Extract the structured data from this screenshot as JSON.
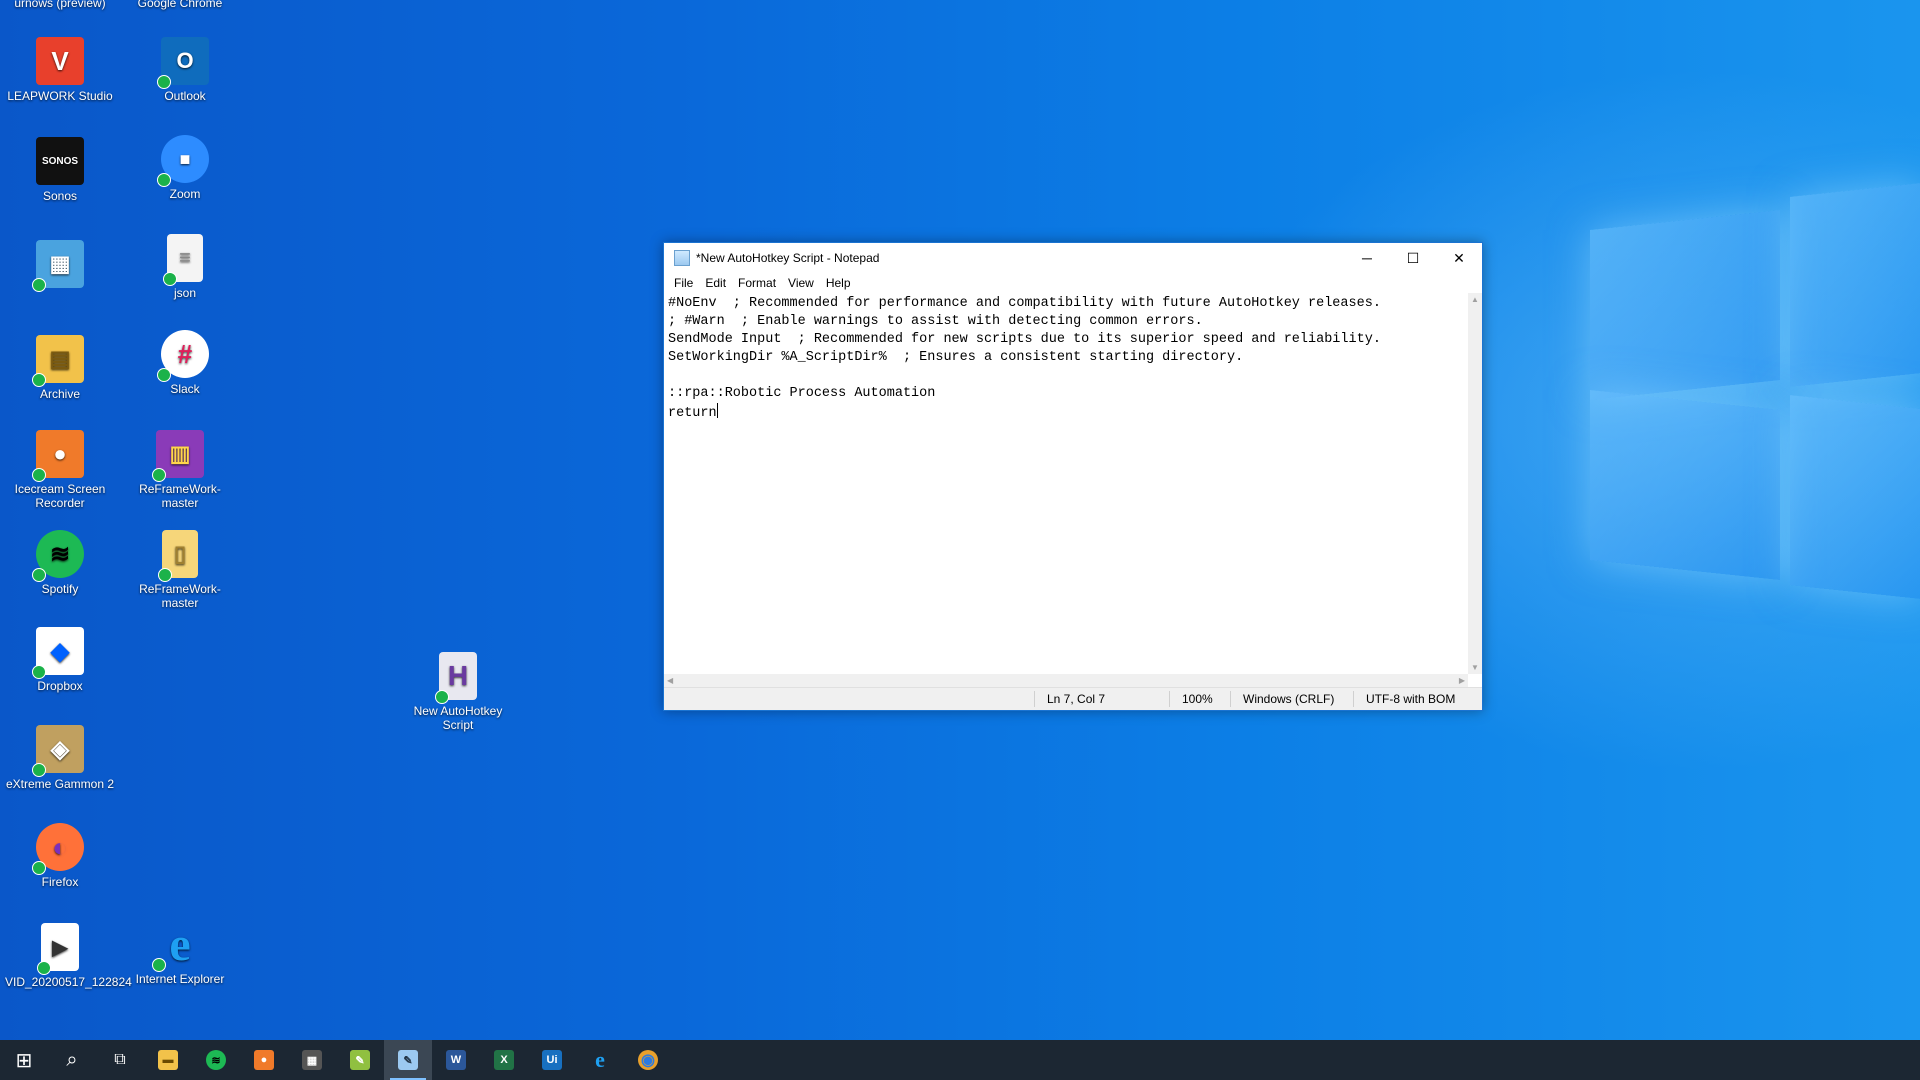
{
  "desktop": {
    "icons": [
      {
        "label": "LEAPWORK Studio",
        "color": "#e8402c",
        "glyph": "V"
      },
      {
        "label": "Outlook",
        "color": "#0f6cbd",
        "glyph": "O"
      },
      {
        "label": "Sonos",
        "color": "#111111",
        "glyph": "SONOS"
      },
      {
        "label": "Zoom",
        "color": "#2d8cff",
        "glyph": "■"
      },
      {
        "label": "",
        "color": "#4aa3df",
        "glyph": "▦"
      },
      {
        "label": "json",
        "color": "#f4f4f4",
        "glyph": "≡"
      },
      {
        "label": "Archive",
        "color": "#f2c24a",
        "glyph": "▤"
      },
      {
        "label": "Slack",
        "color": "#ffffff",
        "glyph": "#"
      },
      {
        "label": "Icecream Screen Recorder",
        "color": "#f07a2a",
        "glyph": "●"
      },
      {
        "label": "ReFrameWork-master",
        "color": "#8a3bb8",
        "glyph": "▥"
      },
      {
        "label": "Spotify",
        "color": "#1db954",
        "glyph": "≋"
      },
      {
        "label": "ReFrameWork-master",
        "color": "#f6d67a",
        "glyph": "▯"
      },
      {
        "label": "Dropbox",
        "color": "#ffffff",
        "glyph": "◆"
      },
      {
        "label": "New AutoHotkey Script",
        "color": "#e8e8f0",
        "glyph": "H"
      },
      {
        "label": "eXtreme Gammon 2",
        "color": "#c0a060",
        "glyph": "◈"
      },
      {
        "label": "Firefox",
        "color": "#ff7139",
        "glyph": "◐"
      },
      {
        "label": "VID_20200517_122824",
        "color": "#ffffff",
        "glyph": "▶"
      },
      {
        "label": "Internet Explorer",
        "color": "#1ea0f2",
        "glyph": "e"
      }
    ],
    "partial_top": [
      "urnows (preview)",
      "Google Chrome"
    ]
  },
  "notepad": {
    "title": "*New AutoHotkey Script - Notepad",
    "menu": [
      "File",
      "Edit",
      "Format",
      "View",
      "Help"
    ],
    "lines": [
      "#NoEnv  ; Recommended for performance and compatibility with future AutoHotkey releases.",
      "; #Warn  ; Enable warnings to assist with detecting common errors.",
      "SendMode Input  ; Recommended for new scripts due to its superior speed and reliability.",
      "SetWorkingDir %A_ScriptDir%  ; Ensures a consistent starting directory.",
      "",
      "::rpa::Robotic Process Automation",
      "return"
    ],
    "status": {
      "position": "Ln 7, Col 7",
      "zoom": "100%",
      "line_endings": "Windows (CRLF)",
      "encoding": "UTF-8 with BOM"
    },
    "controls": {
      "minimize": "─",
      "maximize": "☐",
      "close": "✕"
    }
  },
  "taskbar": {
    "start": "⊞",
    "search": "⌕",
    "taskview": "⧉",
    "apps": [
      {
        "name": "file-explorer",
        "glyph": "▬",
        "color": "#f2c24a"
      },
      {
        "name": "spotify",
        "glyph": "≋",
        "color": "#1db954"
      },
      {
        "name": "icecream",
        "glyph": "●",
        "color": "#f07a2a"
      },
      {
        "name": "calculator",
        "glyph": "▦",
        "color": "#ffffff"
      },
      {
        "name": "notepadpp",
        "glyph": "✎",
        "color": "#90c040"
      },
      {
        "name": "notepad",
        "glyph": "✎",
        "color": "#9cc9f0",
        "active": true
      },
      {
        "name": "word",
        "glyph": "W",
        "color": "#2b579a"
      },
      {
        "name": "excel",
        "glyph": "X",
        "color": "#217346"
      },
      {
        "name": "uipath",
        "glyph": "Ui",
        "color": "#1870c0"
      },
      {
        "name": "edge",
        "glyph": "e",
        "color": "#1ea0f2"
      },
      {
        "name": "chrome",
        "glyph": "◉",
        "color": "#e8a02c"
      }
    ]
  }
}
